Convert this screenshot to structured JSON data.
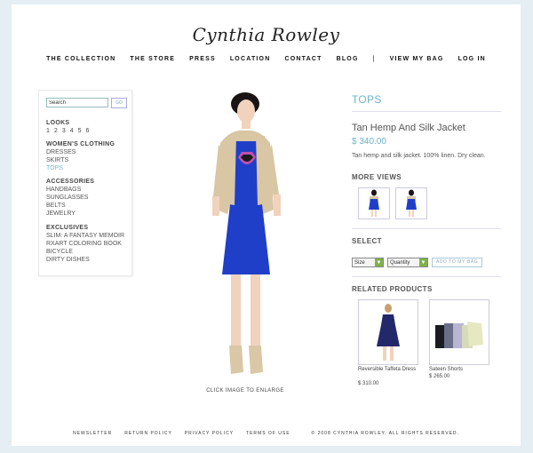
{
  "brand": {
    "logo_text": "Cynthia Rowley"
  },
  "topnav": [
    "THE COLLECTION",
    "THE STORE",
    "PRESS",
    "LOCATION",
    "CONTACT",
    "BLOG",
    "|",
    "VIEW MY BAG",
    "LOG IN"
  ],
  "sidebar": {
    "search_value": "Search",
    "go_label": "GO",
    "looks_heading": "LOOKS",
    "looks": [
      "1",
      "2",
      "3",
      "4",
      "5",
      "6"
    ],
    "womens_heading": "WOMEN'S CLOTHING",
    "womens_items": [
      "DRESSES",
      "SKIRTS",
      "TOPS"
    ],
    "accessories_heading": "ACCESSORIES",
    "accessories_items": [
      "HANDBAGS",
      "SUNGLASSES",
      "BELTS",
      "JEWELRY"
    ],
    "exclusives_heading": "EXCLUSIVES",
    "exclusives_items": [
      "SLIM: A FANTASY MEMOIR",
      "RXART COLORING BOOK",
      "BICYCLE",
      "DIRTY DISHES"
    ]
  },
  "main": {
    "click_enlarge": "CLICK IMAGE TO ENLARGE"
  },
  "product": {
    "category": "TOPS",
    "name": "Tan Hemp And Silk Jacket",
    "price": "$ 340.00",
    "description": "Tan hemp and silk jacket. 100% linen. Dry clean.",
    "more_views_heading": "MORE VIEWS",
    "select_heading": "SELECT",
    "size_label": "Size",
    "quantity_label": "Quantity",
    "add_to_bag": "ADD TO MY BAG",
    "related_heading": "RELATED PRODUCTS",
    "related": [
      {
        "name": "Reversible Taffeta Dress",
        "price": "$ 310.00"
      },
      {
        "name": "Sateen Shorts",
        "price": "$ 265.00"
      }
    ]
  },
  "footer": {
    "links": [
      "NEWSLETTER",
      "RETURN POLICY",
      "PRIVACY POLICY",
      "TERMS OF USE"
    ],
    "copyright": "© 2008 CYNTHIA ROWLEY. ALL RIGHTS RESERVED."
  },
  "colors": {
    "accent": "#6fb3cb",
    "page_bg": "#e4eef3",
    "dress_blue": "#1f3fc8",
    "jacket_tan": "#d8c6a4",
    "select_arrow": "#7fb24a"
  }
}
